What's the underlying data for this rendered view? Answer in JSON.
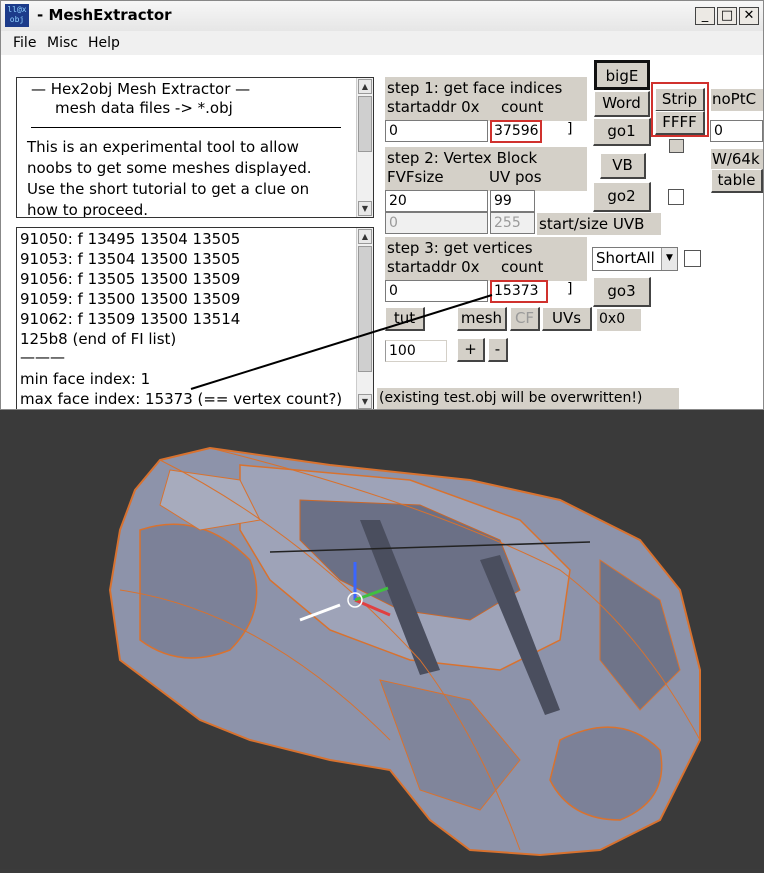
{
  "window": {
    "title": "MeshExtractor",
    "icon_text_top": "ll@x",
    "icon_text_bottom": "obj",
    "controls": [
      "_",
      "□",
      "✕"
    ]
  },
  "menu": [
    {
      "label": "File",
      "accel": "F"
    },
    {
      "label": "Misc",
      "accel": "M"
    },
    {
      "label": "Help",
      "accel": "H"
    }
  ],
  "info": {
    "title": "—   Hex2obj Mesh Extractor   —",
    "subtitle": "mesh data files -> *.obj",
    "lines": [
      "This is an experimental tool to allow",
      "noobs to get some meshes displayed.",
      "Use the short tutorial to get a clue on",
      "how to proceed."
    ]
  },
  "log": {
    "lines": [
      "91050: f  13495 13504 13505",
      "91053: f  13504 13500 13505",
      "91056: f  13505 13500 13509",
      "91059: f  13500 13500 13509",
      "91062: f  13509 13500 13514",
      "125b8 (end of FI list)",
      "———",
      "min face index: 1",
      "max face index: 15373 (== vertex count?)"
    ]
  },
  "step1": {
    "heading": "step 1: get face indices",
    "addr_label": "startaddr 0x",
    "count_label": "count",
    "addr_value": "0",
    "count_value": "37596"
  },
  "step2": {
    "heading": "step 2: Vertex Block",
    "fvf_label": "FVFsize",
    "uv_label": "UV pos",
    "fvf_value": "20",
    "uv_value": "99",
    "start_value": "0",
    "size_value": "255",
    "uvb_label": "start/size UVB"
  },
  "step3": {
    "heading": "step 3: get vertices",
    "addr_label": "startaddr 0x",
    "count_label": "count",
    "addr_value": "0",
    "count_value": "15373"
  },
  "buttons": {
    "bigE": "bigE",
    "word": "Word",
    "strip": "Strip",
    "ffff": "FFFF",
    "noptc": "noPtC",
    "go1": "go1",
    "vb": "VB",
    "w64k": "W/64k",
    "table": "table",
    "go2": "go2",
    "go3": "go3",
    "tut": "tut",
    "mesh": "mesh",
    "cf": "CF",
    "uvs": "UVs",
    "plus": "+",
    "minus": "-"
  },
  "misc": {
    "noptc_value": "0",
    "shortall": "ShortAll",
    "offset_label": "0x0",
    "zoom_value": "100",
    "overwrite_note": "(existing test.obj will be overwritten!)"
  },
  "colors": {
    "highlight": "#d0312d",
    "mesh_body": "#8d93aa",
    "mesh_edges": "#d8722f",
    "viewport_bg": "#3a3a3a"
  }
}
